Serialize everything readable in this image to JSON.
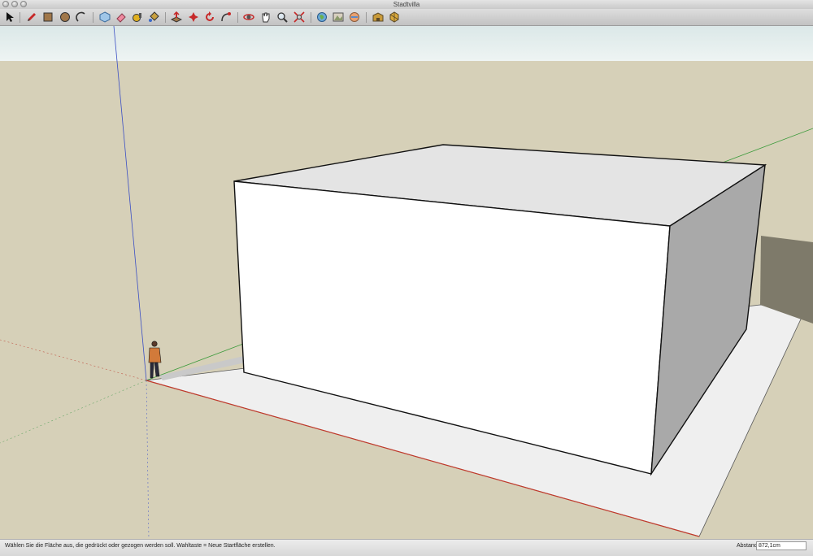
{
  "window": {
    "title": "Stadtvilla"
  },
  "toolbar": {
    "tools": [
      {
        "name": "select-tool",
        "icon": "arrow-cursor-icon"
      },
      {
        "name": "line-tool",
        "icon": "pencil-icon"
      },
      {
        "name": "rectangle-tool",
        "icon": "rectangle-icon"
      },
      {
        "name": "circle-tool",
        "icon": "circle-icon"
      },
      {
        "name": "arc-tool",
        "icon": "arc-icon"
      },
      {
        "name": "make-component-tool",
        "icon": "component-icon"
      },
      {
        "name": "eraser-tool",
        "icon": "eraser-icon"
      },
      {
        "name": "tape-measure-tool",
        "icon": "tape-measure-icon"
      },
      {
        "name": "paint-bucket-tool",
        "icon": "paint-bucket-icon"
      },
      {
        "name": "push-pull-tool",
        "icon": "push-pull-icon"
      },
      {
        "name": "move-tool",
        "icon": "move-icon"
      },
      {
        "name": "rotate-tool",
        "icon": "rotate-icon"
      },
      {
        "name": "follow-me-tool",
        "icon": "follow-me-icon"
      },
      {
        "name": "orbit-tool",
        "icon": "orbit-icon"
      },
      {
        "name": "pan-tool",
        "icon": "hand-icon"
      },
      {
        "name": "zoom-tool",
        "icon": "magnifier-icon"
      },
      {
        "name": "zoom-extents-tool",
        "icon": "zoom-extents-icon"
      },
      {
        "name": "geo-location-tool",
        "icon": "globe-icon"
      },
      {
        "name": "toggle-terrain-tool",
        "icon": "terrain-icon"
      },
      {
        "name": "photo-textures-tool",
        "icon": "photo-textures-icon"
      },
      {
        "name": "3d-warehouse-tool",
        "icon": "warehouse-icon"
      },
      {
        "name": "extension-warehouse-tool",
        "icon": "extension-icon"
      }
    ]
  },
  "colors": {
    "ground": "#d6d0b8",
    "sky": "#e8f1f1",
    "face_front": "#ffffff",
    "face_top": "#e4e4e4",
    "face_side": "#a9a9a9",
    "shadow": "#7e7a6a",
    "footprint": "#f0f0f0",
    "axis_red": "#c0392b",
    "axis_green": "#3a9a3a",
    "axis_blue": "#3b4fc4"
  },
  "status": {
    "hint": "Wählen Sie die Fläche aus, die gedrückt oder gezogen werden soll. Wahltaste = Neue Startfläche erstellen.",
    "measurement_label": "Abstand",
    "measurement_value": "872,1cm"
  }
}
